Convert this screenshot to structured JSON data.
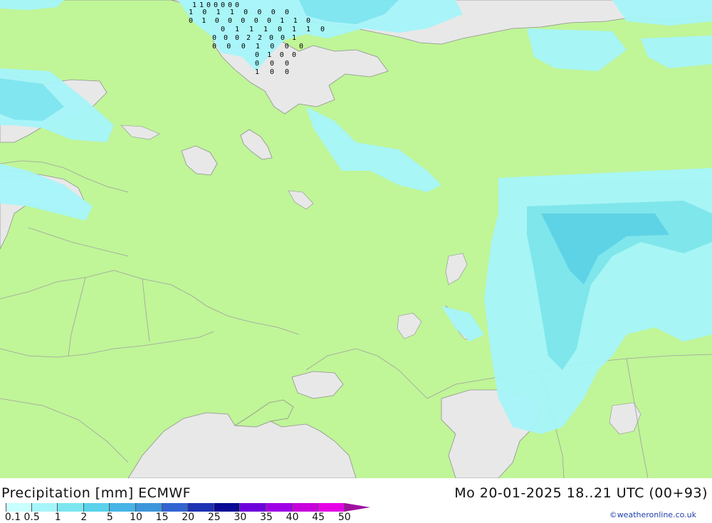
{
  "footer": {
    "title": "Precipitation [mm] ECMWF",
    "date": "Mo 20-01-2025 18..21 UTC (00+93)",
    "credit": "©weatheronline.co.uk"
  },
  "legend": {
    "labels": [
      "0.1",
      "0.5",
      "1",
      "2",
      "5",
      "10",
      "15",
      "20",
      "25",
      "30",
      "35",
      "40",
      "45",
      "50"
    ],
    "colors": [
      "#c8ffff",
      "#a6f5fa",
      "#7ce6f0",
      "#5ad2eb",
      "#46b4e6",
      "#3c96dc",
      "#3264d2",
      "#1e32b4",
      "#0a0a96",
      "#6e00dc",
      "#a000e6",
      "#c800dc",
      "#e600e6",
      "#c800b4"
    ]
  },
  "map": {
    "land_color": "#c0f598",
    "sea_color": "#e8e8e8",
    "border_color": "#a0a0a0",
    "coast_color": "#909090",
    "precip_light": "#a6f5fa",
    "precip_mid": "#7ce6f0",
    "value_color": "#000000",
    "grid_values": [
      {
        "row": [
          10,
          270,
          330,
          400
        ],
        "vals": "1 1 0 0 0 0 0"
      },
      {
        "row": [
          20,
          265,
          400
        ],
        "vals": "1 0 1 1 0 0 0 0"
      },
      {
        "row": [
          32,
          265,
          430
        ],
        "vals": "0 1 0 0 0 0 0 1 1 0"
      },
      {
        "row": [
          44,
          310,
          450
        ],
        "vals": "0 1 1 1 0 1 1 0"
      },
      {
        "row": [
          56,
          298,
          410
        ],
        "vals": "0 0 0 2 2 0 0 1"
      },
      {
        "row": [
          68,
          298,
          420
        ],
        "vals": "0 0 0 1 0 0 0"
      },
      {
        "row": [
          80,
          358,
          410
        ],
        "vals": "0 1 0 0"
      },
      {
        "row": [
          92,
          358,
          400
        ],
        "vals": "0 0 0"
      },
      {
        "row": [
          104,
          358,
          400
        ],
        "vals": "1 0 0"
      }
    ]
  }
}
